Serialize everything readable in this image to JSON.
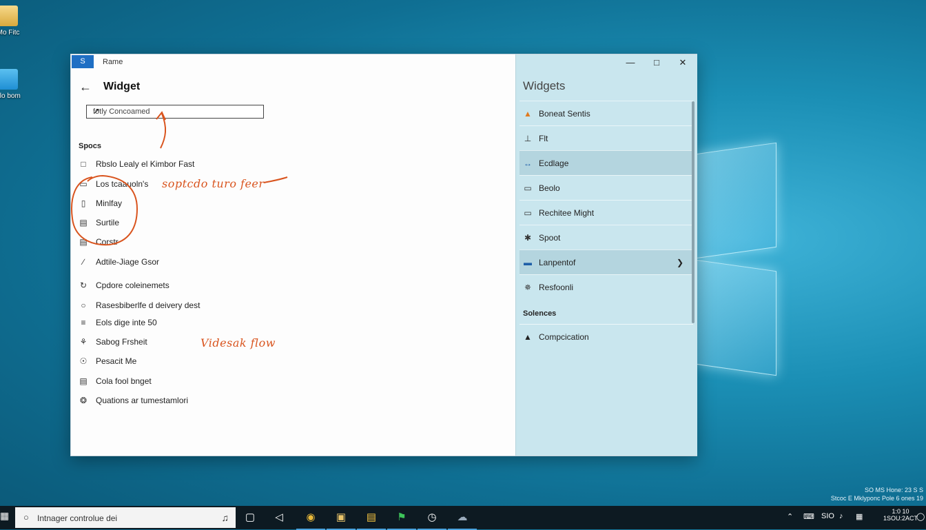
{
  "desktop": {
    "icons": [
      {
        "label": "Mo Fitc",
        "icon": "folder-icon"
      },
      {
        "label": "dlo bom",
        "icon": "windows-app-icon"
      }
    ],
    "clock_lines": [
      "SO MS Hone: 23 S S",
      "Stcoc E Mklyponc Pole 6 ones 19"
    ]
  },
  "window": {
    "app_icon_text": "S",
    "app_title": "Rame",
    "page_title": "Widget",
    "search": {
      "value": "fotly Concoamed"
    },
    "section_label": "Spocs",
    "items": [
      {
        "label": "Rbslo Lealy el Kimbor Fast",
        "icon": "□"
      },
      {
        "label": "Los tcaauoln's",
        "icon": "▭"
      },
      {
        "label": "Minlfay",
        "icon": "▯"
      },
      {
        "label": "Surtile",
        "icon": "▤"
      },
      {
        "label": "Corstr",
        "icon": "▤"
      },
      {
        "label": "Adtile-Jiage Gsor",
        "icon": "∕"
      },
      {
        "label": "Cpdore coleinemets",
        "icon": "↻"
      },
      {
        "label": "Rasesbiberlfe d deivery dest",
        "icon": "○"
      },
      {
        "label": "Eols dige inte 50",
        "icon": "≡"
      },
      {
        "label": "Sabog Frsheit",
        "icon": "⚘"
      },
      {
        "label": "Pesacit Me",
        "icon": "☉"
      },
      {
        "label": "Cola fool bnget",
        "icon": "▤"
      },
      {
        "label": "Quations ar tumestamlori",
        "icon": "❂"
      }
    ],
    "annotations": {
      "top": "soptcdo turo feer",
      "bottom": "Videsak flow"
    },
    "controls": {
      "minimize": "—",
      "maximize": "□",
      "close": "✕"
    }
  },
  "widgets": {
    "title": "Widgets",
    "items": [
      {
        "label": "Boneat Sentis",
        "icon": "▲"
      },
      {
        "label": "Flt",
        "icon": "⊥"
      },
      {
        "label": "Ecdlage",
        "icon": "↔"
      },
      {
        "label": "Beolo",
        "icon": "▭"
      },
      {
        "label": "Rechitee Might",
        "icon": "▭"
      },
      {
        "label": "Spoot",
        "icon": "✱"
      },
      {
        "label": "Lanpentof",
        "icon": "▬"
      },
      {
        "label": "Resfoonli",
        "icon": "✵"
      }
    ],
    "section_label": "Solences",
    "section_item": {
      "label": "Compcication",
      "icon": "▲"
    }
  },
  "taskbar": {
    "search_placeholder": "Intnager controlue dei",
    "tray_text": "SIO",
    "clock": [
      "1:0 10",
      "1SOU:2ACT"
    ]
  }
}
